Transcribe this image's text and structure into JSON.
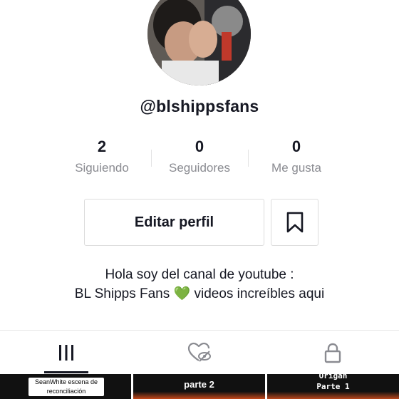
{
  "profile": {
    "username": "@blshippsfans",
    "avatar_alt": "avatar"
  },
  "stats": [
    {
      "value": "2",
      "label": "Siguiendo"
    },
    {
      "value": "0",
      "label": "Seguidores"
    },
    {
      "value": "0",
      "label": "Me gusta"
    }
  ],
  "actions": {
    "edit_label": "Editar perfil",
    "bookmark_icon": "bookmark-icon"
  },
  "bio": {
    "line1": "Hola soy del canal de youtube :",
    "line2_prefix": "BL Shipps Fans ",
    "heart": "💚",
    "line2_suffix": " videos increíbles aqui"
  },
  "tabs": [
    {
      "icon": "grid-icon",
      "active": true
    },
    {
      "icon": "liked-hidden-icon",
      "active": false
    },
    {
      "icon": "lock-icon",
      "active": false
    }
  ],
  "videos": [
    {
      "caption_line1": "SeanWhite escena de",
      "caption_line2": "reconciliación"
    },
    {
      "caption": "parte 2"
    },
    {
      "caption_line1": "Origan",
      "caption_line2": "Parte 1"
    }
  ],
  "colors": {
    "text": "#161823",
    "muted": "#8a8b91",
    "border": "#dcdcdc",
    "heart": "#2fa84f"
  }
}
